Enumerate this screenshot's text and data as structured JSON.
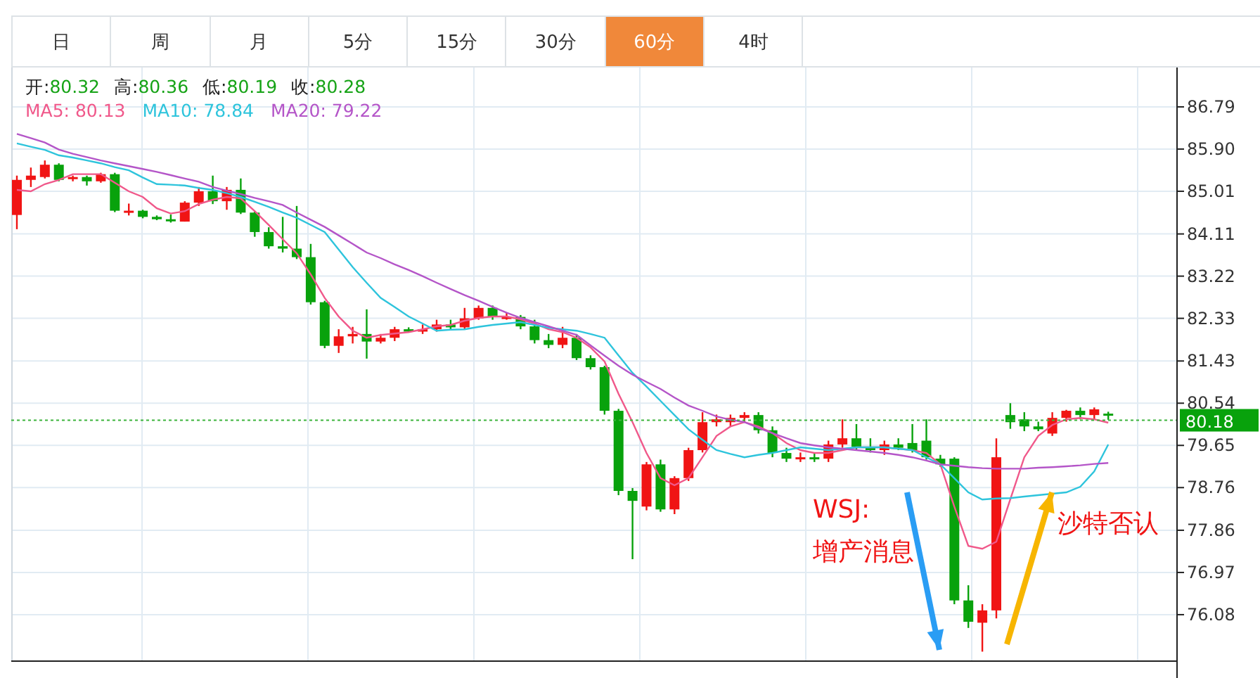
{
  "tabs": [
    {
      "label": "日",
      "selected": false
    },
    {
      "label": "周",
      "selected": false
    },
    {
      "label": "月",
      "selected": false
    },
    {
      "label": "5分",
      "selected": false
    },
    {
      "label": "15分",
      "selected": false
    },
    {
      "label": "30分",
      "selected": false
    },
    {
      "label": "60分",
      "selected": true
    },
    {
      "label": "4时",
      "selected": false
    }
  ],
  "quote": [
    {
      "label": "开:",
      "value": "80.32"
    },
    {
      "label": "高:",
      "value": "80.36"
    },
    {
      "label": "低:",
      "value": "80.19"
    },
    {
      "label": "收:",
      "value": "80.28"
    }
  ],
  "moving_averages": [
    {
      "value": ": 80.13"
    },
    {
      "value": ": 78.84"
    },
    {
      "value": ": 79.22"
    }
  ],
  "chart": {
    "chart_data": {
      "type": "candlestick",
      "grid": true,
      "ylim": [
        75.1,
        87.62
      ],
      "yticks": [
        86.79,
        {
          "value": 85.9,
          "label": "85.90"
        },
        85.01,
        84.11,
        83.22,
        82.33,
        81.43,
        80.54,
        79.65,
        78.76,
        77.86,
        76.97,
        76.08
      ],
      "ref_lines": [
        {
          "axis": "y",
          "value": 80.18,
          "label": "80.18"
        }
      ],
      "series": [
        {
          "name": "MA5",
          "type": "line",
          "color": "#f0588a",
          "values": [
            85.04,
            85.01,
            85.16,
            85.25,
            85.37,
            85.37,
            85.37,
            85.19,
            85.01,
            84.89,
            84.65,
            84.54,
            84.59,
            84.74,
            84.83,
            84.89,
            84.86,
            84.59,
            84.3,
            84.0,
            83.7,
            83.26,
            82.76,
            82.37,
            82.07,
            81.92,
            81.98,
            82.01,
            82.04,
            82.1,
            82.16,
            82.19,
            82.28,
            82.34,
            82.37,
            82.37,
            82.31,
            82.22,
            82.1,
            82.04,
            81.92,
            81.72,
            81.42,
            80.74,
            80.14,
            79.49,
            78.96,
            78.81,
            78.96,
            79.4,
            79.85,
            80.05,
            80.14,
            80.05,
            79.91,
            79.7,
            79.55,
            79.49,
            79.49,
            79.55,
            79.61,
            79.61,
            79.61,
            79.58,
            79.55,
            79.49,
            79.25,
            78.36,
            77.53,
            77.47,
            77.62,
            78.51,
            79.4,
            79.85,
            80.08,
            80.2,
            80.23,
            80.2,
            80.13
          ]
        },
        {
          "name": "MA10",
          "type": "line",
          "color": "#2ec4dc",
          "values": [
            86.02,
            85.95,
            85.88,
            85.77,
            85.72,
            85.66,
            85.6,
            85.52,
            85.45,
            85.3,
            85.16,
            85.15,
            85.13,
            85.08,
            85.04,
            84.97,
            84.89,
            84.79,
            84.68,
            84.56,
            84.45,
            84.3,
            84.15,
            83.78,
            83.41,
            83.08,
            82.76,
            82.57,
            82.37,
            82.22,
            82.07,
            82.09,
            82.1,
            82.15,
            82.19,
            82.22,
            82.25,
            82.19,
            82.13,
            82.1,
            82.07,
            82.0,
            81.92,
            81.55,
            81.18,
            80.89,
            80.59,
            80.29,
            79.99,
            79.77,
            79.55,
            79.47,
            79.4,
            79.45,
            79.49,
            79.55,
            79.61,
            79.58,
            79.55,
            79.58,
            79.61,
            79.61,
            79.61,
            79.58,
            79.55,
            79.4,
            79.25,
            78.96,
            78.66,
            78.51,
            78.53,
            78.54,
            78.57,
            78.6,
            78.63,
            78.66,
            78.78,
            79.1,
            79.67
          ]
        },
        {
          "name": "MA20",
          "type": "line",
          "color": "#b455c8",
          "values": [
            86.22,
            86.13,
            86.04,
            85.89,
            85.8,
            85.73,
            85.66,
            85.6,
            85.54,
            85.48,
            85.42,
            85.35,
            85.28,
            85.21,
            85.1,
            85.02,
            84.95,
            84.87,
            84.8,
            84.72,
            84.56,
            84.41,
            84.26,
            84.08,
            83.9,
            83.72,
            83.6,
            83.47,
            83.35,
            83.22,
            83.08,
            82.95,
            82.82,
            82.7,
            82.57,
            82.45,
            82.34,
            82.25,
            82.16,
            82.07,
            81.98,
            81.76,
            81.54,
            81.33,
            81.14,
            80.99,
            80.84,
            80.66,
            80.49,
            80.38,
            80.26,
            80.19,
            80.14,
            80.02,
            79.91,
            79.8,
            79.7,
            79.65,
            79.61,
            79.58,
            79.55,
            79.52,
            79.49,
            79.45,
            79.4,
            79.33,
            79.25,
            79.22,
            79.19,
            79.17,
            79.16,
            79.16,
            79.16,
            79.18,
            79.19,
            79.21,
            79.23,
            79.26,
            79.28
          ]
        }
      ],
      "ohlc": [
        [
          84.51,
          85.34,
          84.21,
          85.25
        ],
        [
          85.25,
          85.51,
          85.1,
          85.34
        ],
        [
          85.31,
          85.66,
          85.28,
          85.57
        ],
        [
          85.57,
          85.6,
          85.22,
          85.25
        ],
        [
          85.28,
          85.34,
          85.22,
          85.31
        ],
        [
          85.31,
          85.34,
          85.13,
          85.22
        ],
        [
          85.22,
          85.4,
          85.19,
          85.37
        ],
        [
          85.37,
          85.4,
          84.57,
          84.6
        ],
        [
          84.6,
          84.75,
          84.5,
          84.6
        ],
        [
          84.6,
          84.62,
          84.44,
          84.47
        ],
        [
          84.47,
          84.5,
          84.4,
          84.42
        ],
        [
          84.42,
          84.52,
          84.35,
          84.4
        ],
        [
          84.37,
          84.8,
          84.37,
          84.77
        ],
        [
          84.77,
          85.1,
          84.7,
          85.01
        ],
        [
          85.01,
          85.34,
          84.74,
          84.8
        ],
        [
          84.8,
          85.1,
          84.62,
          85.04
        ],
        [
          85.04,
          85.28,
          84.53,
          84.56
        ],
        [
          84.56,
          84.58,
          84.05,
          84.15
        ],
        [
          84.15,
          84.25,
          83.8,
          83.85
        ],
        [
          83.85,
          84.47,
          83.72,
          83.8
        ],
        [
          83.8,
          84.7,
          83.58,
          83.62
        ],
        [
          83.62,
          83.9,
          82.62,
          82.67
        ],
        [
          82.67,
          82.7,
          81.7,
          81.75
        ],
        [
          81.75,
          82.1,
          81.6,
          81.95
        ],
        [
          81.95,
          82.15,
          81.8,
          82
        ],
        [
          82,
          82.52,
          81.48,
          81.84
        ],
        [
          81.84,
          82,
          81.8,
          81.92
        ],
        [
          81.92,
          82.15,
          81.85,
          82.1
        ],
        [
          82.1,
          82.14,
          82.03,
          82.05
        ],
        [
          82.05,
          82.2,
          82,
          82.1
        ],
        [
          82.1,
          82.3,
          82.05,
          82.2
        ],
        [
          82.2,
          82.3,
          82.1,
          82.14
        ],
        [
          82.14,
          82.55,
          82.1,
          82.33
        ],
        [
          82.33,
          82.6,
          82.3,
          82.55
        ],
        [
          82.55,
          82.6,
          82.3,
          82.36
        ],
        [
          82.36,
          82.45,
          82.3,
          82.36
        ],
        [
          82.36,
          82.4,
          82.1,
          82.16
        ],
        [
          82.16,
          82.3,
          81.8,
          81.87
        ],
        [
          81.87,
          82,
          81.7,
          81.77
        ],
        [
          81.77,
          82.15,
          81.7,
          81.92
        ],
        [
          81.92,
          82,
          81.45,
          81.49
        ],
        [
          81.49,
          81.55,
          81.25,
          81.3
        ],
        [
          81.3,
          81.33,
          80.3,
          80.38
        ],
        [
          80.38,
          80.42,
          78.6,
          78.69
        ],
        [
          78.69,
          78.75,
          77.25,
          78.48
        ],
        [
          78.36,
          79.3,
          78.28,
          79.25
        ],
        [
          79.25,
          79.35,
          78.25,
          78.3
        ],
        [
          78.3,
          79,
          78.2,
          78.96
        ],
        [
          78.96,
          79.6,
          78.9,
          79.55
        ],
        [
          79.55,
          80.35,
          79.5,
          80.14
        ],
        [
          80.14,
          80.3,
          80.05,
          80.2
        ],
        [
          80.14,
          80.3,
          80.05,
          80.23
        ],
        [
          80.23,
          80.35,
          80.15,
          80.29
        ],
        [
          80.29,
          80.35,
          79.9,
          79.97
        ],
        [
          79.97,
          80.05,
          79.4,
          79.49
        ],
        [
          79.49,
          79.6,
          79.3,
          79.37
        ],
        [
          79.37,
          79.5,
          79.3,
          79.4
        ],
        [
          79.4,
          79.5,
          79.3,
          79.37
        ],
        [
          79.37,
          79.75,
          79.3,
          79.67
        ],
        [
          79.67,
          80.2,
          79.6,
          79.8
        ],
        [
          79.8,
          80.1,
          79.55,
          79.62
        ],
        [
          79.62,
          79.8,
          79.5,
          79.55
        ],
        [
          79.55,
          79.75,
          79.45,
          79.67
        ],
        [
          79.67,
          79.8,
          79.55,
          79.6
        ],
        [
          79.7,
          80.1,
          79.5,
          79.55
        ],
        [
          79.75,
          80.2,
          79.35,
          79.4
        ],
        [
          79.37,
          79.45,
          79.2,
          79.25
        ],
        [
          79.37,
          79.4,
          76.3,
          76.38
        ],
        [
          76.38,
          76.7,
          75.8,
          75.93
        ],
        [
          75.91,
          76.3,
          75.3,
          76.17
        ],
        [
          76.17,
          79.8,
          76,
          79.4
        ],
        [
          80.29,
          80.54,
          80,
          80.14
        ],
        [
          80.2,
          80.35,
          79.95,
          80.05
        ],
        [
          80.05,
          80.15,
          79.95,
          79.99
        ],
        [
          79.9,
          80.35,
          79.85,
          80.23
        ],
        [
          80.23,
          80.4,
          80.15,
          80.38
        ],
        [
          80.38,
          80.45,
          80.2,
          80.29
        ],
        [
          80.29,
          80.45,
          80.2,
          80.41
        ],
        [
          80.32,
          80.36,
          80.19,
          80.28
        ]
      ]
    },
    "annotations": [
      {
        "kind": "text",
        "lines": [
          "WSJ:",
          "增产消息"
        ]
      },
      {
        "kind": "arrow",
        "color": "#2a9df4"
      },
      {
        "kind": "text",
        "lines": [
          "沙特否认"
        ]
      },
      {
        "kind": "arrow",
        "color": "#f7b500"
      }
    ]
  }
}
